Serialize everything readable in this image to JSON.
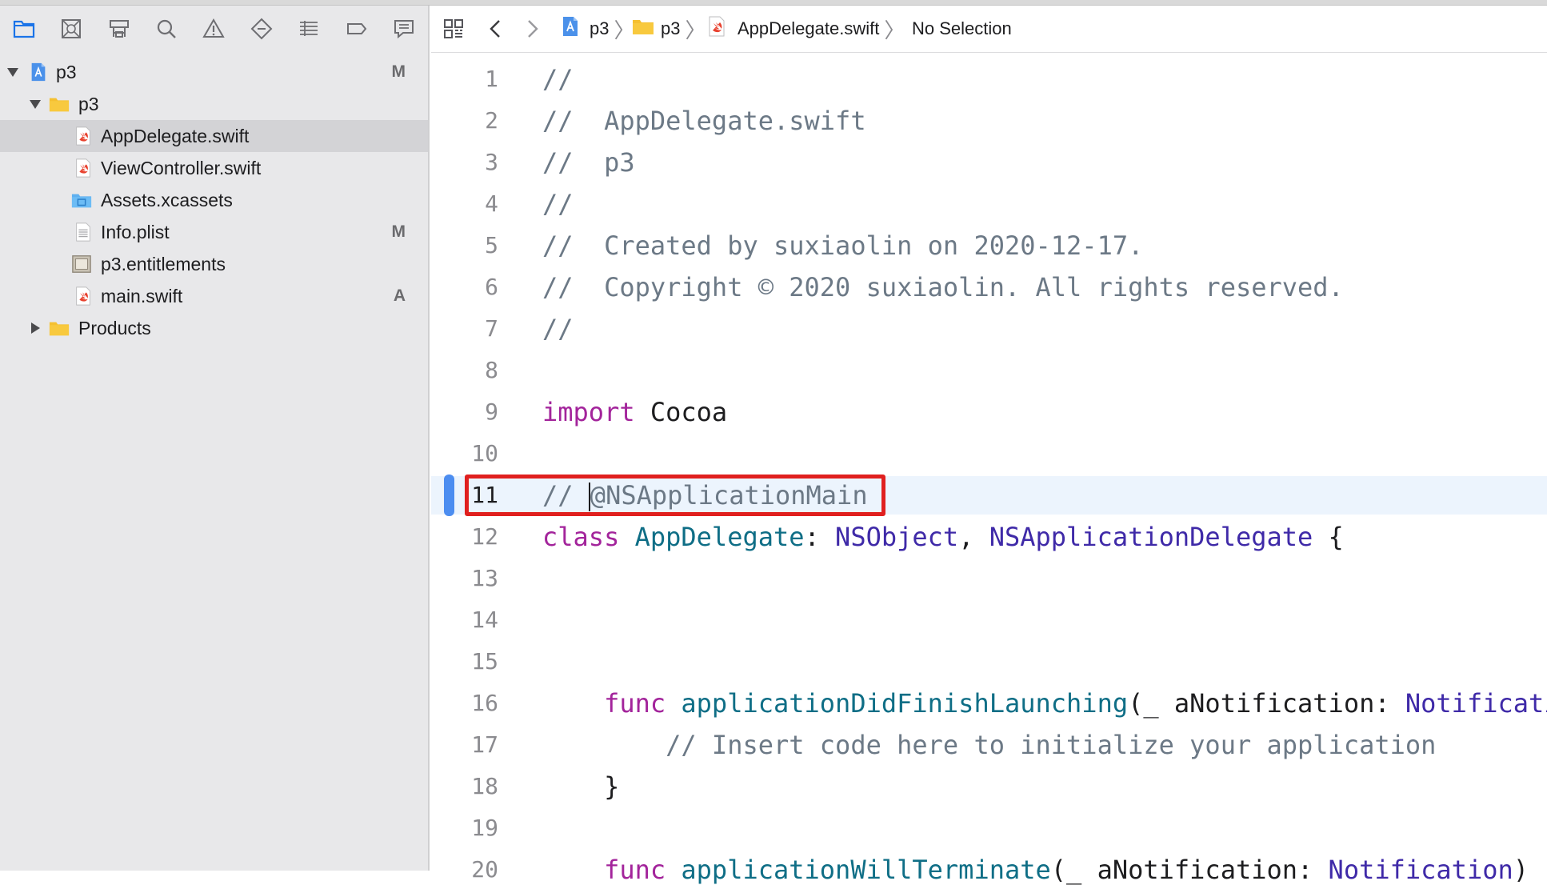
{
  "navigator_tabs": [
    "project-navigator-icon",
    "source-control-icon",
    "symbol-navigator-icon",
    "find-icon",
    "issue-icon",
    "test-icon",
    "debug-icon",
    "breakpoint-nav-icon",
    "report-icon"
  ],
  "tree": {
    "root": {
      "label": "p3",
      "badge": "M"
    },
    "group": {
      "label": "p3"
    },
    "files": [
      {
        "label": "AppDelegate.swift",
        "badge": "",
        "icon": "swift-file-icon"
      },
      {
        "label": "ViewController.swift",
        "badge": "",
        "icon": "swift-file-icon"
      },
      {
        "label": "Assets.xcassets",
        "badge": "",
        "icon": "asset-catalog-icon"
      },
      {
        "label": "Info.plist",
        "badge": "M",
        "icon": "plist-file-icon"
      },
      {
        "label": "p3.entitlements",
        "badge": "",
        "icon": "entitlements-file-icon"
      },
      {
        "label": "main.swift",
        "badge": "A",
        "icon": "swift-file-icon"
      }
    ],
    "products": {
      "label": "Products"
    }
  },
  "jumpbar": {
    "crumbs": [
      "p3",
      "p3",
      "AppDelegate.swift",
      "No Selection"
    ]
  },
  "code": {
    "current_line": 11,
    "lines": [
      {
        "n": "1",
        "t": "//"
      },
      {
        "n": "2",
        "t": "//  AppDelegate.swift"
      },
      {
        "n": "3",
        "t": "//  p3"
      },
      {
        "n": "4",
        "t": "//"
      },
      {
        "n": "5",
        "t": "//  Created by suxiaolin on 2020-12-17."
      },
      {
        "n": "6",
        "t": "//  Copyright © 2020 suxiaolin. All rights reserved."
      },
      {
        "n": "7",
        "t": "//"
      },
      {
        "n": "8",
        "t": ""
      },
      {
        "n": "9",
        "kw": "import",
        "rest": " Cocoa"
      },
      {
        "n": "10",
        "t": ""
      },
      {
        "n": "11",
        "t_pre": "// ",
        "t_post": "@NSApplicationMain"
      },
      {
        "n": "12",
        "kw": "class",
        "name": " AppDelegate",
        "colon": ": ",
        "t1": "NSObject",
        "comma": ", ",
        "t2": "NSApplicationDelegate",
        "brace": " {"
      },
      {
        "n": "13",
        "t": ""
      },
      {
        "n": "14",
        "t": ""
      },
      {
        "n": "15",
        "t": ""
      },
      {
        "n": "16",
        "indent": "    ",
        "kw": "func",
        "name": " applicationDidFinishLaunching",
        "args": "(_ aNotification: ",
        "type": "Notificati"
      },
      {
        "n": "17",
        "t": "        // Insert code here to initialize your application"
      },
      {
        "n": "18",
        "t": "    }"
      },
      {
        "n": "19",
        "t": ""
      },
      {
        "n": "20",
        "indent": "    ",
        "kw": "func",
        "name": " applicationWillTerminate",
        "args": "(_ aNotification: ",
        "type": "Notification",
        "tail": ") -"
      }
    ]
  },
  "colors": {
    "keyword": "#a3249b",
    "comment": "#6c7986",
    "type": "#0f6e86",
    "highlight": "#e0201f",
    "breakpoint": "#4c8df0"
  }
}
